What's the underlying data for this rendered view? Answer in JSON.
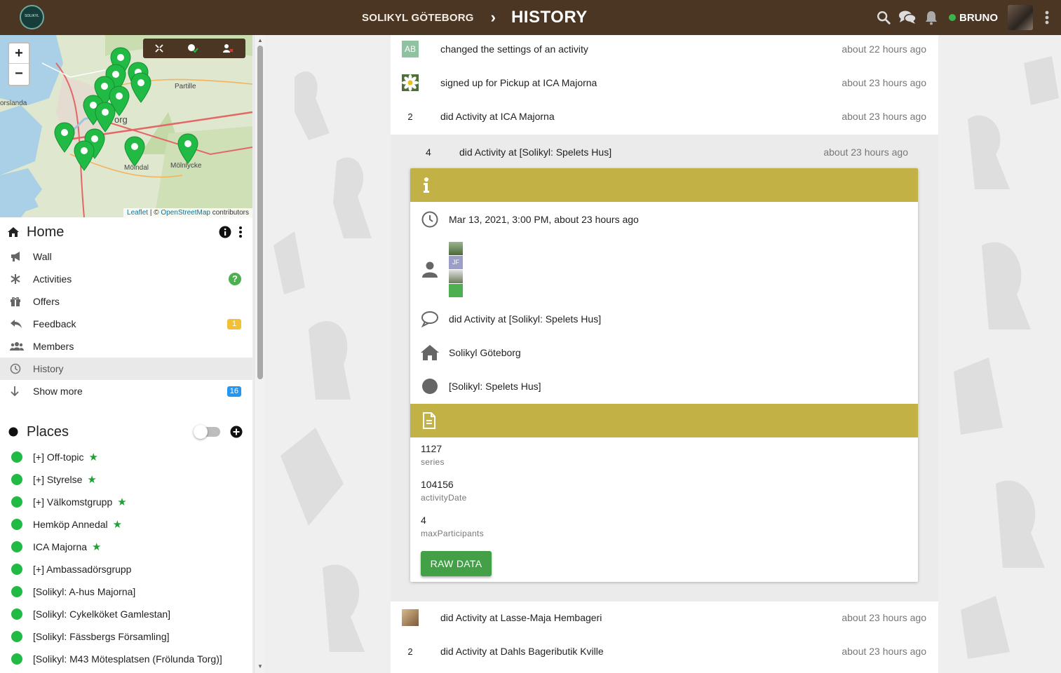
{
  "header": {
    "group_name": "SOLIKYL GÖTEBORG",
    "page_title": "HISTORY",
    "user_name": "BRUNO",
    "logo_text": "SOLIKYL"
  },
  "map": {
    "labels": [
      "Partille",
      "org",
      "Mölndal",
      "Mölnlycke",
      "orslanda"
    ],
    "zoom_in": "+",
    "zoom_out": "−",
    "attribution_leaflet": "Leaflet",
    "attribution_sep": " | © ",
    "attribution_osm": "OpenStreetMap",
    "attribution_tail": " contributors"
  },
  "sidebar": {
    "home_title": "Home",
    "nav": [
      {
        "label": "Wall",
        "icon": "megaphone-icon"
      },
      {
        "label": "Activities",
        "icon": "asterisk-icon"
      },
      {
        "label": "Offers",
        "icon": "gift-icon"
      },
      {
        "label": "Feedback",
        "icon": "reply-icon",
        "badge": "1"
      },
      {
        "label": "Members",
        "icon": "users-icon"
      },
      {
        "label": "History",
        "icon": "clock-icon",
        "active": true
      },
      {
        "label": "Show more",
        "icon": "arrow-down-icon",
        "badge": "16"
      }
    ],
    "activities_help": "?",
    "places_title": "Places",
    "places": [
      {
        "name": "[+] Off-topic",
        "starred": true
      },
      {
        "name": "[+] Styrelse",
        "starred": true
      },
      {
        "name": "[+] Välkomstgrupp",
        "starred": true
      },
      {
        "name": "Hemköp Annedal",
        "starred": true
      },
      {
        "name": "ICA Majorna",
        "starred": true
      },
      {
        "name": "[+] Ambassadörsgrupp",
        "starred": false
      },
      {
        "name": "[Solikyl: A-hus Majorna]",
        "starred": false
      },
      {
        "name": "[Solikyl: Cykelköket Gamlestan]",
        "starred": false
      },
      {
        "name": "[Solikyl: Fässbergs Församling]",
        "starred": false
      },
      {
        "name": "[Solikyl: M43 Mötesplatsen (Frölunda Torg)]",
        "starred": false
      }
    ]
  },
  "history": [
    {
      "avatar": "AB",
      "text": "changed the settings of an activity",
      "time": "about 22 hours ago"
    },
    {
      "avatar": "flower",
      "text": "signed up for Pickup at ICA Majorna",
      "time": "about 23 hours ago"
    },
    {
      "avatar": "2",
      "text": "did Activity at ICA Majorna",
      "time": "about 23 hours ago"
    }
  ],
  "expanded": {
    "count": "4",
    "text": "did Activity at [Solikyl: Spelets Hus]",
    "time": "about 23 hours ago",
    "date": "Mar 13, 2021, 3:00 PM, about 23 hours ago",
    "participant_initials": "JF",
    "message": "did Activity at [Solikyl: Spelets Hus]",
    "group": "Solikyl Göteborg",
    "place": "[Solikyl: Spelets Hus]",
    "raw": [
      {
        "value": "1127",
        "key": "series"
      },
      {
        "value": "104156",
        "key": "activityDate"
      },
      {
        "value": "4",
        "key": "maxParticipants"
      }
    ],
    "raw_button": "RAW DATA"
  },
  "history_after": [
    {
      "avatar": "photo",
      "text": "did Activity at Lasse-Maja Hembageri",
      "time": "about 23 hours ago"
    },
    {
      "avatar": "2",
      "text": "did Activity at Dahls Bageributik Kville",
      "time": "about 23 hours ago"
    }
  ],
  "colors": {
    "topbar": "#4a3622",
    "card_header": "#c2b144",
    "place_dot": "#21ba45",
    "button": "#43a047"
  }
}
